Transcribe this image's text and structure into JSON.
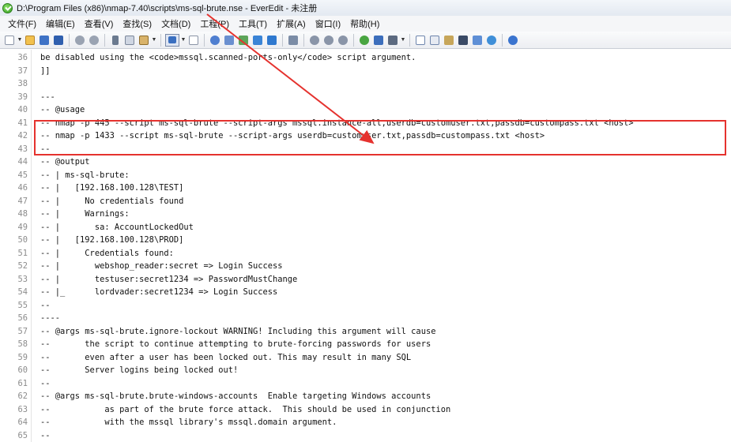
{
  "window": {
    "title": "D:\\Program Files (x86)\\nmap-7.40\\scripts\\ms-sql-brute.nse - EverEdit - 未注册"
  },
  "menu": [
    "文件(F)",
    "编辑(E)",
    "查看(V)",
    "查找(S)",
    "文档(D)",
    "工程(P)",
    "工具(T)",
    "扩展(A)",
    "窗口(I)",
    "帮助(H)"
  ],
  "toolbar_icons": [
    "new-file",
    "open-folder",
    "save",
    "save-all",
    "undo",
    "redo",
    "cut",
    "copy",
    "paste",
    "view-mode",
    "column-mode",
    "find",
    "find-in-files",
    "replace",
    "bookmark",
    "clip",
    "wrap",
    "script",
    "settings",
    "plugin",
    "browser",
    "tools",
    "terminal",
    "compare",
    "file-panel",
    "output",
    "project",
    "web",
    "help"
  ],
  "editor": {
    "lines": [
      {
        "n": "36",
        "text": "be disabled using the <code>mssql.scanned-ports-only</code> script argument."
      },
      {
        "n": "37",
        "text": "]]"
      },
      {
        "n": "38",
        "text": ""
      },
      {
        "n": "39",
        "text": "---"
      },
      {
        "n": "40",
        "text": "-- @usage"
      },
      {
        "n": "41",
        "text": "-- nmap -p 445 --script ms-sql-brute --script-args mssql.instance-all,userdb=customuser.txt,passdb=custompass.txt <host>"
      },
      {
        "n": "42",
        "text": "-- nmap -p 1433 --script ms-sql-brute --script-args userdb=customuser.txt,passdb=custompass.txt <host>"
      },
      {
        "n": "43",
        "text": "--"
      },
      {
        "n": "44",
        "text": "-- @output"
      },
      {
        "n": "45",
        "text": "-- | ms-sql-brute:"
      },
      {
        "n": "46",
        "text": "-- |   [192.168.100.128\\TEST]"
      },
      {
        "n": "47",
        "text": "-- |     No credentials found"
      },
      {
        "n": "48",
        "text": "-- |     Warnings:"
      },
      {
        "n": "49",
        "text": "-- |       sa: AccountLockedOut"
      },
      {
        "n": "50",
        "text": "-- |   [192.168.100.128\\PROD]"
      },
      {
        "n": "51",
        "text": "-- |     Credentials found:"
      },
      {
        "n": "52",
        "text": "-- |       webshop_reader:secret => Login Success"
      },
      {
        "n": "53",
        "text": "-- |       testuser:secret1234 => PasswordMustChange"
      },
      {
        "n": "54",
        "text": "-- |_      lordvader:secret1234 => Login Success"
      },
      {
        "n": "55",
        "text": "--"
      },
      {
        "n": "56",
        "text": "----"
      },
      {
        "n": "57",
        "text": "-- @args ms-sql-brute.ignore-lockout WARNING! Including this argument will cause"
      },
      {
        "n": "58",
        "text": "--       the script to continue attempting to brute-forcing passwords for users"
      },
      {
        "n": "59",
        "text": "--       even after a user has been locked out. This may result in many SQL"
      },
      {
        "n": "60",
        "text": "--       Server logins being locked out!"
      },
      {
        "n": "61",
        "text": "--"
      },
      {
        "n": "62",
        "text": "-- @args ms-sql-brute.brute-windows-accounts  Enable targeting Windows accounts"
      },
      {
        "n": "63",
        "text": "--           as part of the brute force attack.  This should be used in conjunction"
      },
      {
        "n": "64",
        "text": "--           with the mssql library's mssql.domain argument."
      },
      {
        "n": "65",
        "text": "--"
      }
    ]
  },
  "annotation": {
    "color": "#e5322e"
  }
}
